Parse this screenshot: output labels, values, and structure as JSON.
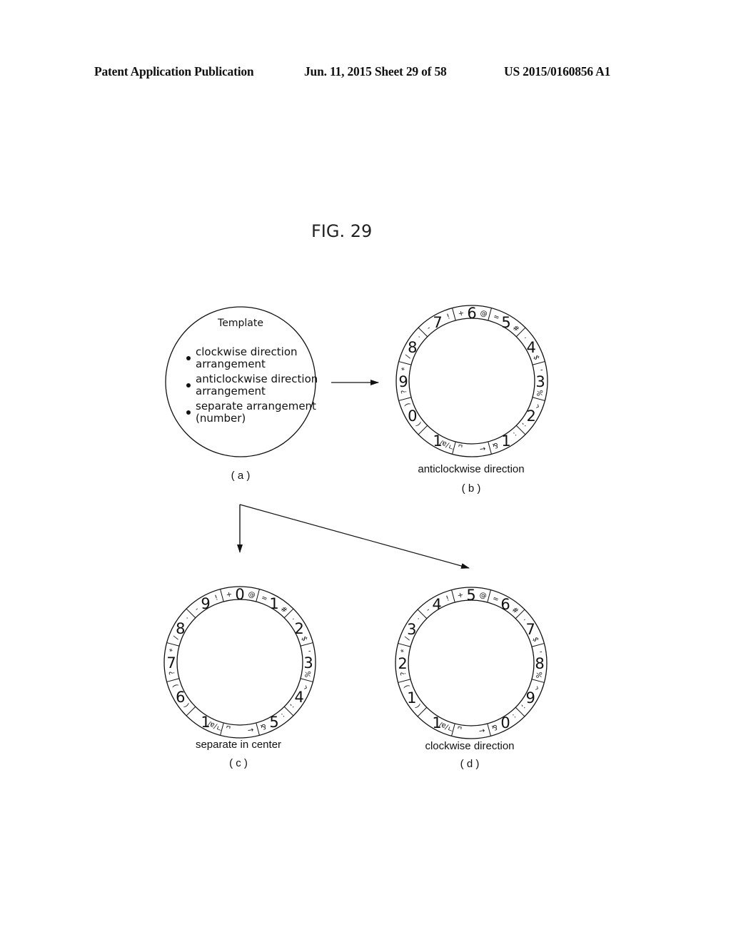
{
  "header": {
    "left": "Patent Application Publication",
    "middle": "Jun. 11, 2015  Sheet 29 of 58",
    "right": "US 2015/0160856 A1"
  },
  "figure": {
    "title": "FIG. 29",
    "panel_a": {
      "heading": "Template",
      "bullets": [
        [
          "clockwise direction",
          "arrangement"
        ],
        [
          "anticlockwise direction",
          "arrangement"
        ],
        [
          "separate arrangement",
          "(number)"
        ]
      ],
      "label": "( a )"
    },
    "panel_b": {
      "caption": "anticlockwise direction",
      "label": "( b )"
    },
    "panel_c": {
      "caption": "separate in center",
      "label": "( c )"
    },
    "panel_d": {
      "caption": "clockwise direction",
      "label": "( d )"
    },
    "ring_segments_symbols": [
      {
        "pre": "+",
        "post": "@"
      },
      {
        "pre": "=",
        "post": "#"
      },
      {
        "pre": "·",
        "post": "$"
      },
      {
        "pre": "'",
        "post": "%"
      },
      {
        "pre": "^",
        "post": ";"
      },
      {
        "pre": ":",
        "post": "&"
      },
      {
        "pre": "←",
        "post": "␣"
      },
      {
        "pre": "ㄱ/a/",
        "post": ""
      },
      {
        "pre": "(",
        "post": ")"
      },
      {
        "pre": "?",
        "post": "*"
      },
      {
        "pre": "/",
        "post": "·"
      },
      {
        "pre": "-",
        "post": "!"
      }
    ],
    "ring_digits": {
      "b": [
        "6",
        "5",
        "4",
        "3",
        "2",
        "1",
        "",
        "1",
        "0",
        "9",
        "8",
        "7"
      ],
      "c": [
        "0",
        "1",
        "2",
        "3",
        "4",
        "5",
        "",
        "1",
        "6",
        "7",
        "8",
        "9"
      ],
      "d": [
        "5",
        "6",
        "7",
        "8",
        "9",
        "0",
        "",
        "1",
        "1",
        "2",
        "3",
        "4"
      ]
    }
  }
}
